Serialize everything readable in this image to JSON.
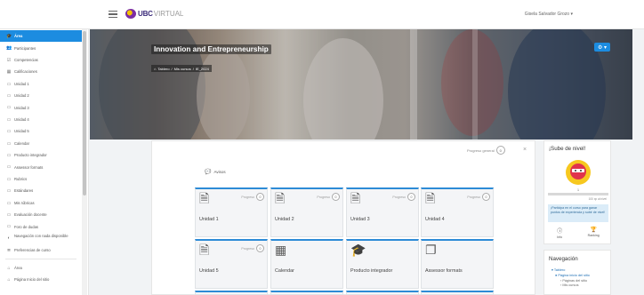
{
  "header": {
    "logo_primary": "UBC",
    "logo_secondary": "VIRTUAL",
    "user_menu": "Gisela Salvador Grozo"
  },
  "sidebar": {
    "items": [
      {
        "label": "Área",
        "icon": "mortarboard-icon",
        "glyph": "🎓",
        "active": true
      },
      {
        "label": "Participantes",
        "icon": "users-icon",
        "glyph": "👥"
      },
      {
        "label": "Competencias",
        "icon": "checklist-icon",
        "glyph": "☑"
      },
      {
        "label": "Calificaciones",
        "icon": "table-icon",
        "glyph": "▦"
      },
      {
        "label": "Unidad 1",
        "icon": "folder-icon",
        "glyph": "▭"
      },
      {
        "label": "Unidad 2",
        "icon": "folder-icon",
        "glyph": "▭"
      },
      {
        "label": "Unidad 3",
        "icon": "folder-icon",
        "glyph": "▭"
      },
      {
        "label": "Unidad 4",
        "icon": "folder-icon",
        "glyph": "▭"
      },
      {
        "label": "Unidad 5",
        "icon": "folder-icon",
        "glyph": "▭"
      },
      {
        "label": "Calendar",
        "icon": "folder-icon",
        "glyph": "▭"
      },
      {
        "label": "Producto integrador",
        "icon": "folder-icon",
        "glyph": "▭"
      },
      {
        "label": "Assessor formats",
        "icon": "folder-icon",
        "glyph": "▭"
      },
      {
        "label": "Rubrics",
        "icon": "folder-icon",
        "glyph": "▭"
      },
      {
        "label": "Estándares",
        "icon": "folder-icon",
        "glyph": "▭"
      },
      {
        "label": "Mis rúbricas",
        "icon": "folder-icon",
        "glyph": "▭"
      },
      {
        "label": "Evaluación docente",
        "icon": "folder-icon",
        "glyph": "▭"
      },
      {
        "label": "Foro de dudas",
        "icon": "folder-icon",
        "glyph": "▭"
      },
      {
        "label": "Navegación con nada disponible",
        "icon": "compass-icon",
        "glyph": "◐",
        "two_line": true
      },
      {
        "label": "Preferencias de curso",
        "icon": "list-icon",
        "glyph": "≣"
      },
      {
        "label": "Área",
        "icon": "home-icon",
        "glyph": "⌂"
      },
      {
        "label": "Página Inicio del sitio",
        "icon": "home-icon",
        "glyph": "⌂"
      }
    ]
  },
  "hero": {
    "course_title": "Innovation and Entrepreneurship",
    "breadcrumb": [
      "Tablero",
      "Mis cursos",
      "IE_2024"
    ],
    "gear_label": "⚙ ▾"
  },
  "course": {
    "overall_progress_label": "Progreso general",
    "overall_progress_value": "0",
    "close_label": "×",
    "aviso_label": "Avisos",
    "tiles": [
      {
        "label": "Unidad 1",
        "icon": "document-icon",
        "glyph": "🗎",
        "progress_label": "Progreso",
        "progress": "0"
      },
      {
        "label": "Unidad 2",
        "icon": "document-icon",
        "glyph": "🗎",
        "progress_label": "Progreso",
        "progress": "0"
      },
      {
        "label": "Unidad 3",
        "icon": "document-icon",
        "glyph": "🗎",
        "progress_label": "Progreso",
        "progress": "0"
      },
      {
        "label": "Unidad 4",
        "icon": "document-icon",
        "glyph": "🗎",
        "progress_label": "Progreso",
        "progress": "0"
      },
      {
        "label": "Unidad 5",
        "icon": "document-icon",
        "glyph": "🗎",
        "progress_label": "Progreso",
        "progress": "0"
      },
      {
        "label": "Calendar",
        "icon": "calendar-icon",
        "glyph": "▦",
        "progress_label": "",
        "progress": ""
      },
      {
        "label": "Producto integrador",
        "icon": "graduation-cap-icon",
        "glyph": "🎓",
        "progress_label": "",
        "progress": ""
      },
      {
        "label": "Assessor formats",
        "icon": "copy-icon",
        "glyph": "❐",
        "progress_label": "",
        "progress": ""
      }
    ]
  },
  "level": {
    "title": "¡Sube de nivel!",
    "level_value": "1",
    "progress_fraction": 0.0,
    "xp_text": "100 xp al nivel",
    "info": "¡Participa en el curso para ganar puntos de experiencia y subir de nivel!",
    "links": [
      {
        "icon": "info-icon",
        "glyph": "ⓘ",
        "label": "Info"
      },
      {
        "icon": "trophy-icon",
        "glyph": "🏆",
        "label": "Ranking"
      }
    ],
    "colors": {
      "badge_red": "#e0334c",
      "badge_yellow": "#f7c81f"
    }
  },
  "navigation": {
    "title": "Navegación",
    "root": "Tablero",
    "items": [
      "Página inicio del sitio",
      "Páginas del sitio",
      "Mis cursos"
    ]
  },
  "colors": {
    "accent": "#1c8ce0",
    "tile_border": "#2d8bd6"
  }
}
